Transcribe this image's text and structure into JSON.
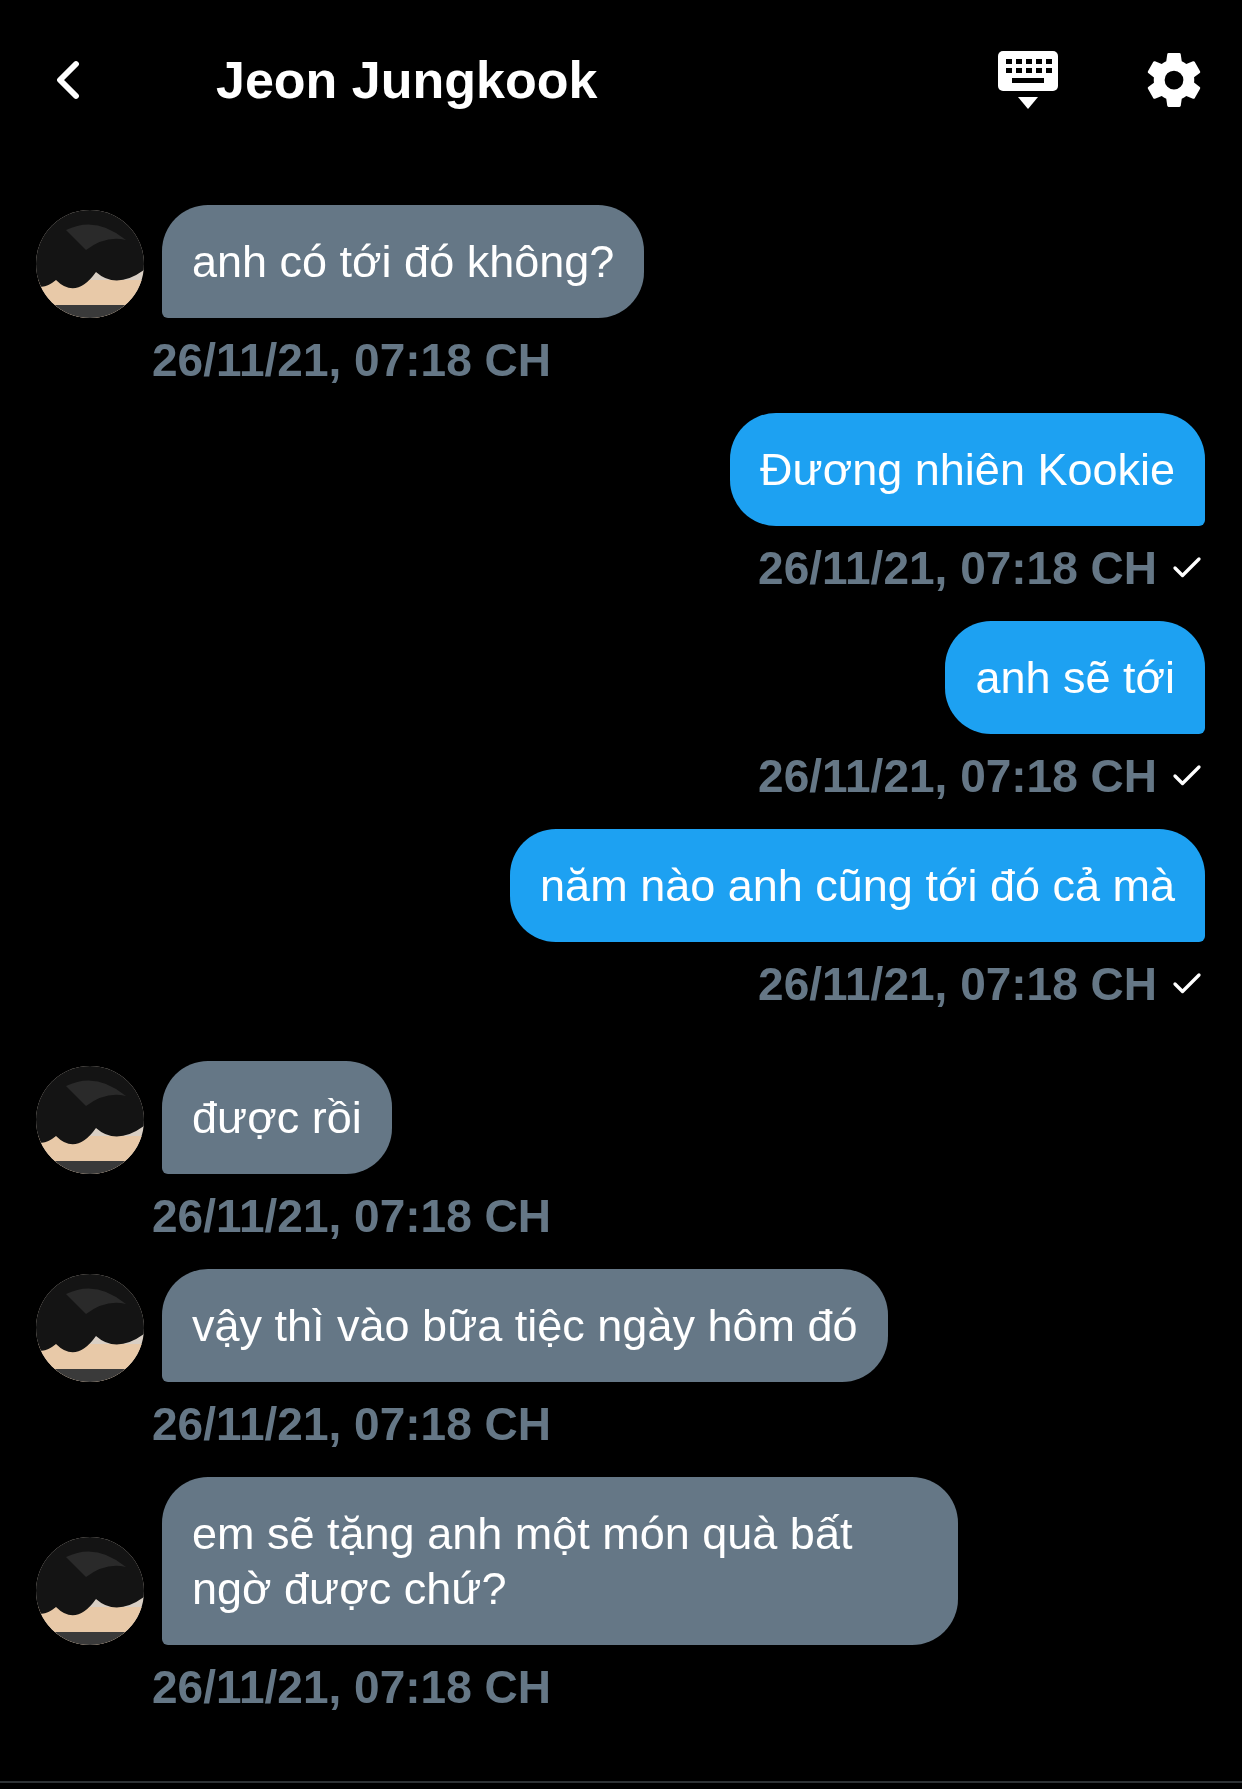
{
  "header": {
    "title": "Jeon Jungkook"
  },
  "messages": [
    {
      "kind": "received",
      "text": "anh có tới đó không?",
      "time": "26/11/21, 07:18 CH",
      "delivered": false
    },
    {
      "kind": "sent",
      "text": "Đương nhiên Kookie",
      "time": "26/11/21, 07:18 CH",
      "delivered": true
    },
    {
      "kind": "sent",
      "text": "anh sẽ tới",
      "time": "26/11/21, 07:18 CH",
      "delivered": true
    },
    {
      "kind": "sent",
      "text": "năm nào anh cũng tới đó cả mà",
      "time": "26/11/21, 07:18 CH",
      "delivered": true
    },
    {
      "kind": "received",
      "text": "được rồi",
      "time": "26/11/21, 07:18 CH",
      "delivered": false
    },
    {
      "kind": "received",
      "text": "vậy thì vào bữa tiệc ngày hôm đó",
      "time": "26/11/21, 07:18 CH",
      "delivered": false
    },
    {
      "kind": "received",
      "text": "em sẽ tặng anh một món quà bất ngờ được chứ?",
      "time": "26/11/21, 07:18 CH",
      "delivered": false
    }
  ]
}
